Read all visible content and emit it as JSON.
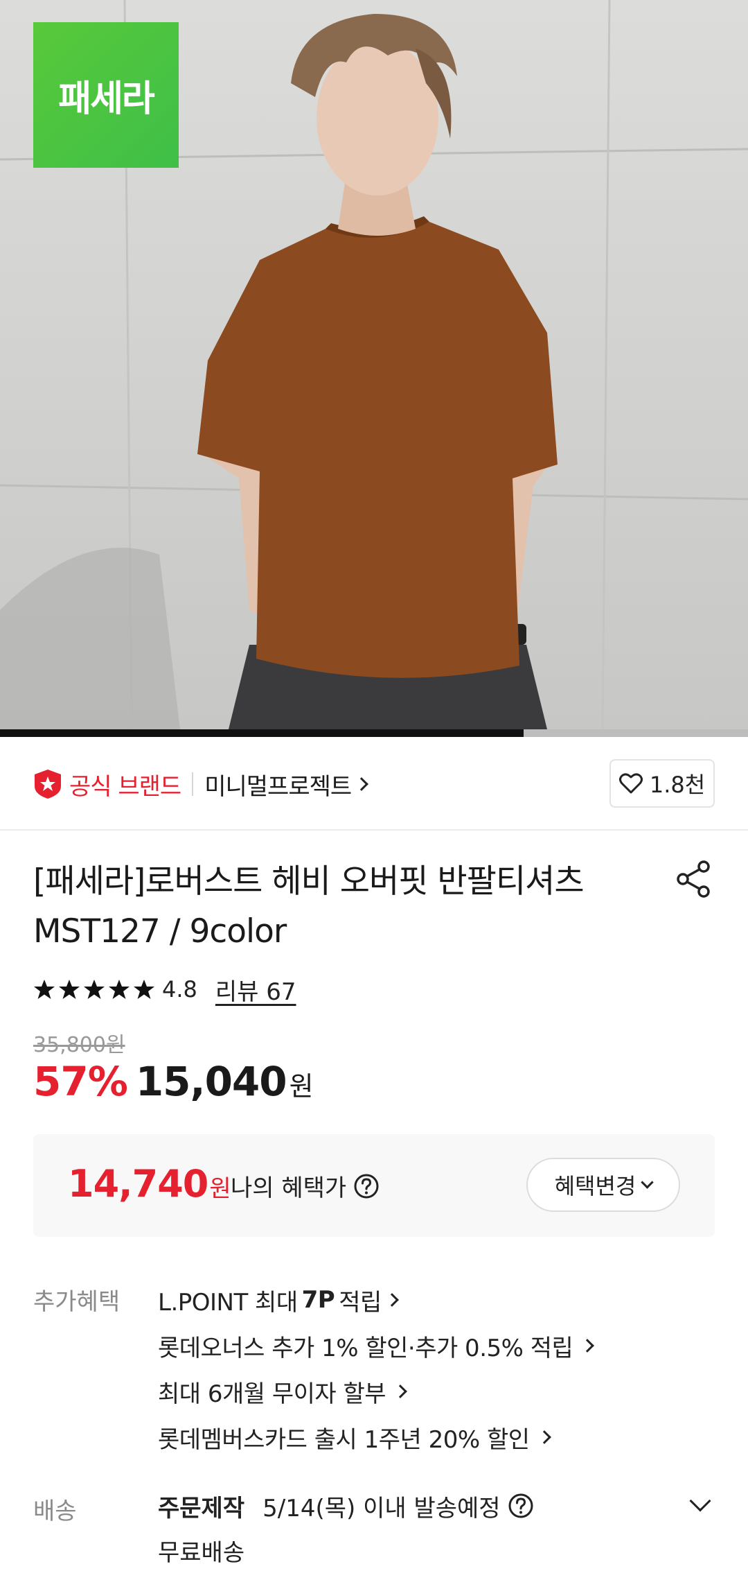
{
  "hero": {
    "badge_text": "패세라",
    "progress": 0.7
  },
  "brand": {
    "official_label": "공식 브랜드",
    "store_name": "미니멀프로젝트",
    "like_count": "1.8천"
  },
  "product": {
    "title_line1": "[패세라]로버스트 헤비 오버핏 반팔티셔츠",
    "title_line2": "MST127 / 9color",
    "rating": "4.8",
    "stars": 5,
    "review_link": "리뷰 67",
    "original_price": "35,800원",
    "discount": "57%",
    "price": "15,040",
    "price_unit": "원"
  },
  "benefit": {
    "price": "14,740",
    "unit": "원",
    "label": "나의 혜택가",
    "change_button": "혜택변경"
  },
  "extra": {
    "label": "추가혜택",
    "items": [
      {
        "pre": "L.POINT 최대",
        "bold": "7P",
        "post": "적립"
      },
      {
        "pre": "롯데오너스 추가 1% 할인·추가 0.5% 적립",
        "bold": "",
        "post": ""
      },
      {
        "pre": "최대 6개월 무이자 할부",
        "bold": "",
        "post": ""
      },
      {
        "pre": "롯데멤버스카드 출시 1주년 20% 할인",
        "bold": "",
        "post": ""
      }
    ]
  },
  "shipping": {
    "label": "배송",
    "made_to_order": "주문제작",
    "date": "5/14(목) 이내 발송예정",
    "free": "무료배송"
  },
  "colors": {
    "accent_red": "#e5202f",
    "badge_green": "#4cc441"
  }
}
